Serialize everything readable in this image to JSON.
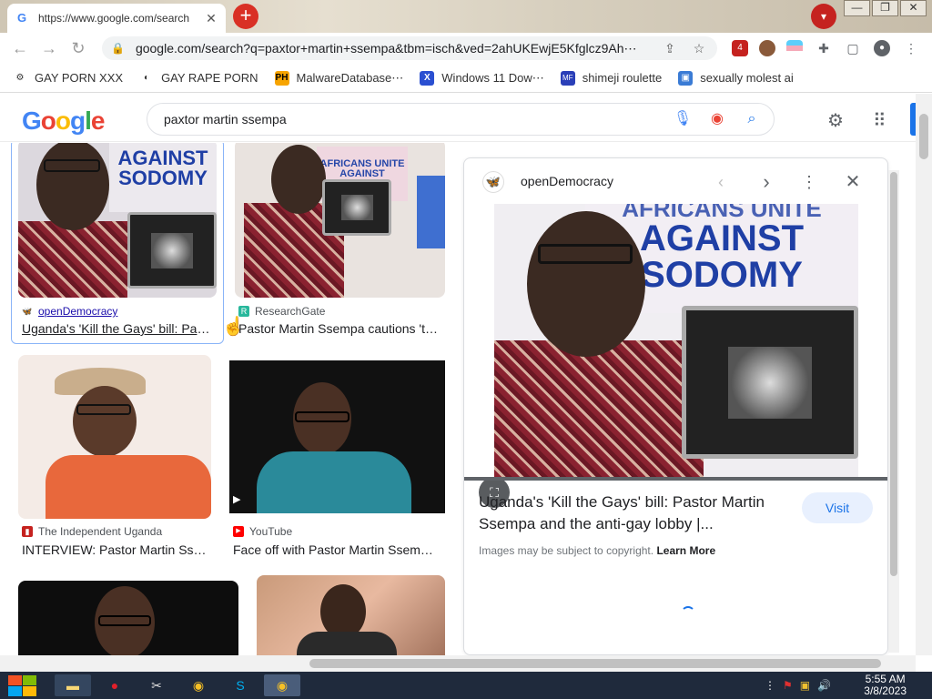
{
  "browser": {
    "tab_title": "https://www.google.com/search",
    "url": "google.com/search?q=paxtor+martin+ssempa&tbm=isch&ved=2ahUKEwjE5Kfglcz9Ah⋯",
    "extension_badge": "4",
    "bookmarks": [
      {
        "label": "GAY PORN XXX",
        "icon": "⚙",
        "color": "#333333"
      },
      {
        "label": "GAY RAPE PORN",
        "icon": "◐",
        "color": "#333333"
      },
      {
        "label": "MalwareDatabase⋯",
        "icon": "PH",
        "color": "#f7a400"
      },
      {
        "label": "Windows 11 Dow⋯",
        "icon": "X",
        "color": "#2a4fd1"
      },
      {
        "label": "shimeji roulette",
        "icon": "MF",
        "color": "#2a3fb8"
      },
      {
        "label": "sexually molest ai",
        "icon": "▣",
        "color": "#3a7bd5"
      }
    ]
  },
  "google": {
    "logo": "Google",
    "query": "paxtor martin ssempa"
  },
  "results": [
    {
      "source": "openDemocracy",
      "title": "Uganda's 'Kill the Gays' bill: Pas…",
      "sign_text": "AGAINST\nSODOMY"
    },
    {
      "source": "ResearchGate",
      "title": "Pastor Martin Ssempa cautions 't…",
      "sign_text": "AFRICANS UNITE\nAGAINST"
    },
    {
      "source": "The Independent Uganda",
      "title": "INTERVIEW: Pastor Martin Sse…"
    },
    {
      "source": "YouTube",
      "title": "Face off with Pastor Martin Ssem…"
    }
  ],
  "preview": {
    "site": "openDemocracy",
    "sign_line1": "AFRICANS UNITE",
    "sign_line2": "AGAINST",
    "sign_line3": "SODOMY",
    "title": "Uganda's 'Kill the Gays' bill: Pastor Martin Ssempa and the anti-gay lobby |...",
    "visit_label": "Visit",
    "copyright_text": "Images may be subject to copyright.",
    "learn_more": "Learn More"
  },
  "taskbar": {
    "time": "5:55 AM",
    "date": "3/8/2023"
  }
}
